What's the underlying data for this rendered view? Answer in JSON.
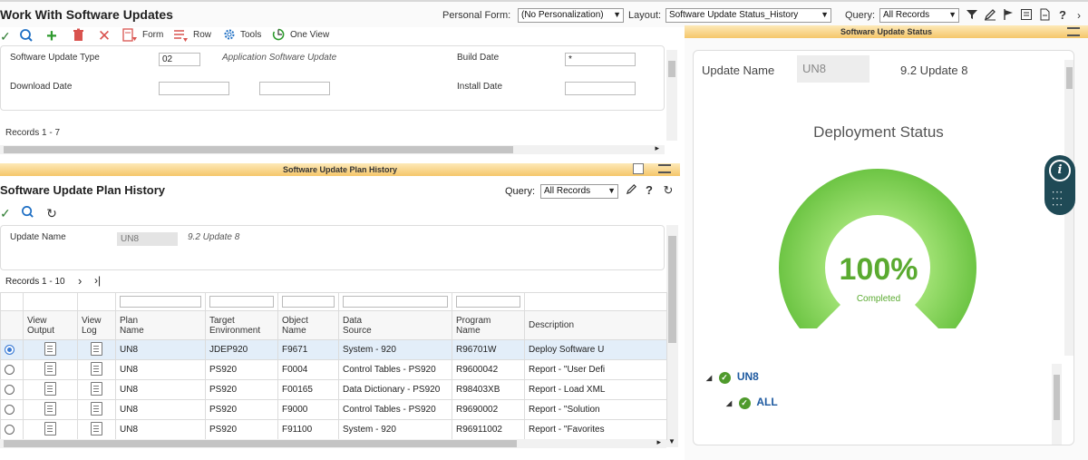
{
  "app": {
    "title": "Work With Software Updates",
    "personal_form_label": "Personal Form:",
    "personal_form_value": "(No Personalization)",
    "layout_label": "Layout:",
    "layout_value": "Software Update Status_History",
    "query_label": "Query:",
    "query_value": "All Records"
  },
  "toolbar": {
    "form_label": "Form",
    "row_label": "Row",
    "tools_label": "Tools",
    "oneview_label": "One View"
  },
  "header_form": {
    "update_type_label": "Software Update Type",
    "update_type_value": "02",
    "update_type_desc": "Application Software Update",
    "build_date_label": "Build Date",
    "build_date_value": "*",
    "download_date_label": "Download Date",
    "install_date_label": "Install Date",
    "records": "Records 1 - 7"
  },
  "history": {
    "banner": "Software Update Plan History",
    "title": "Software Update Plan History",
    "query_label": "Query:",
    "query_value": "All Records",
    "update_name_label": "Update Name",
    "update_name_value": "UN8",
    "update_name_desc": "9.2 Update 8",
    "records": "Records 1 - 10",
    "columns": [
      "View\nOutput",
      "View\nLog",
      "Plan\nName",
      "Target\nEnvironment",
      "Object\nName",
      "Data\nSource",
      "Program\nName",
      "Description"
    ],
    "rows": [
      {
        "plan": "UN8",
        "env": "JDEP920",
        "object": "F9671",
        "source": "System - 920",
        "program": "R96701W",
        "desc": "Deploy Software U"
      },
      {
        "plan": "UN8",
        "env": "PS920",
        "object": "F0004",
        "source": "Control Tables - PS920",
        "program": "R9600042",
        "desc": "Report - \"User Defi"
      },
      {
        "plan": "UN8",
        "env": "PS920",
        "object": "F00165",
        "source": "Data Dictionary - PS920",
        "program": "R98403XB",
        "desc": "Report - Load XML"
      },
      {
        "plan": "UN8",
        "env": "PS920",
        "object": "F9000",
        "source": "Control Tables - PS920",
        "program": "R9690002",
        "desc": "Report - \"Solution"
      },
      {
        "plan": "UN8",
        "env": "PS920",
        "object": "F91100",
        "source": "System - 920",
        "program": "R96911002",
        "desc": "Report - \"Favorites"
      }
    ]
  },
  "status": {
    "banner": "Software Update Status",
    "update_name_label": "Update Name",
    "update_name_value": "UN8",
    "update_name_desc": "9.2 Update 8",
    "chart_title": "Deployment Status",
    "percent_text": "100%",
    "percent": 100,
    "completed_label": "Completed",
    "tree_root": "UN8",
    "tree_child": "ALL"
  },
  "colors": {
    "gauge_inner": "#b6ee88",
    "gauge_outer": "#6cc443",
    "percent_text": "#5aaa30",
    "tree_check": "#4f9a2c",
    "banner": "#f5c66a"
  }
}
